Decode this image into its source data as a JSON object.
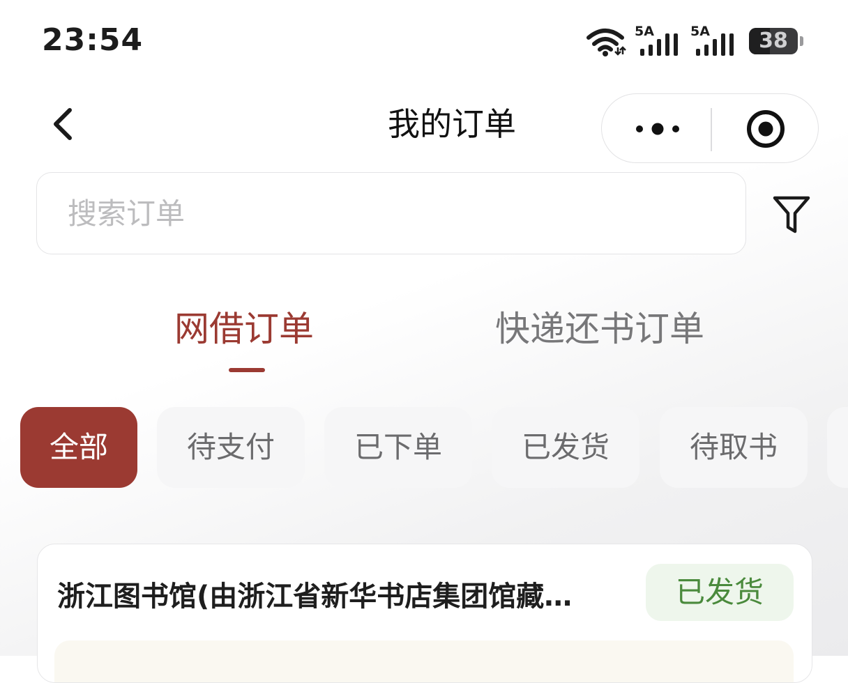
{
  "status_bar": {
    "time": "23:54",
    "network_1": "5A",
    "network_2": "5A",
    "battery": "38",
    "icons": [
      "wifi-icon",
      "signal-icon",
      "signal-icon",
      "battery-icon"
    ]
  },
  "nav": {
    "title": "我的订单",
    "back_icon": "chevron-left-icon",
    "more_icon": "more-dots-icon",
    "target_icon": "target-icon"
  },
  "search": {
    "placeholder": "搜索订单",
    "filter_icon": "filter-icon"
  },
  "tabs": [
    {
      "label": "网借订单",
      "active": true
    },
    {
      "label": "快递还书订单",
      "active": false
    }
  ],
  "chips": [
    {
      "label": "全部",
      "active": true
    },
    {
      "label": "待支付",
      "active": false
    },
    {
      "label": "已下单",
      "active": false
    },
    {
      "label": "已发货",
      "active": false
    },
    {
      "label": "待取书",
      "active": false
    }
  ],
  "order": {
    "library": "浙江图书馆(由浙江省新华书店集团馆藏…",
    "status": "已发货"
  },
  "colors": {
    "accent": "#9b3a32",
    "status_green": "#4a8a3c",
    "status_green_bg": "#eef6ec"
  }
}
